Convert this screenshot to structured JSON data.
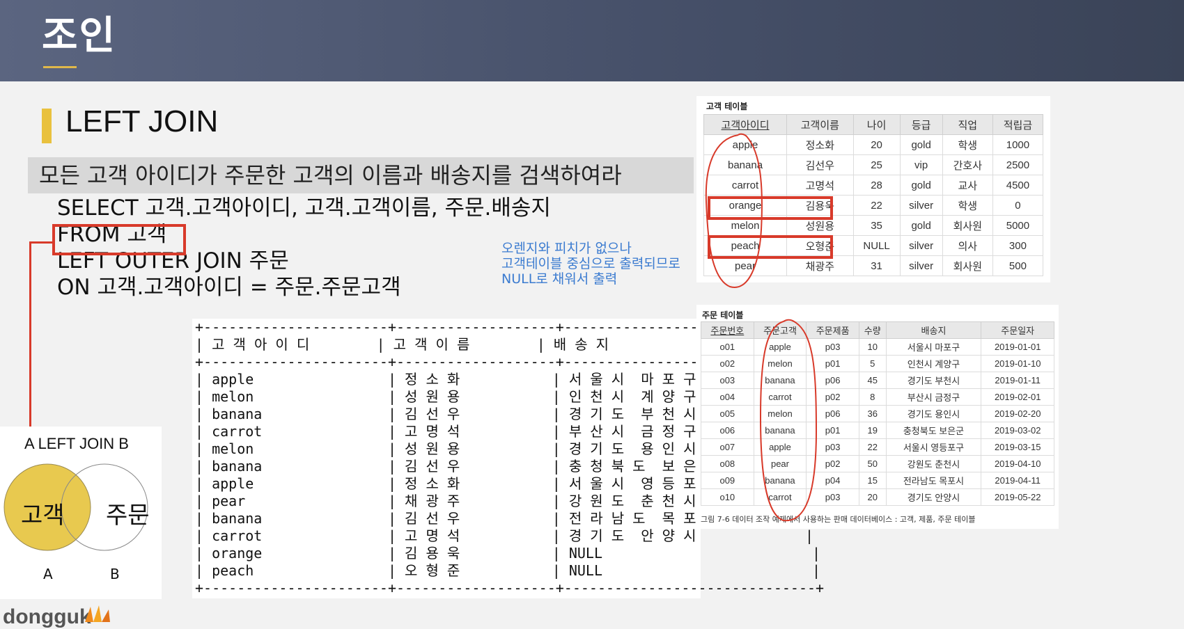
{
  "header": {
    "title": "조인"
  },
  "section": {
    "title": "LEFT JOIN"
  },
  "question": "모든 고객 아이디가 주문한 고객의 이름과 배송지를 검색하여라",
  "sql": {
    "line1": "SELECT 고객.고객아이디,  고객.고객이름,  주문.배송지",
    "line2": "FROM 고객",
    "line3": "LEFT OUTER JOIN 주문",
    "line4": "ON 고객.고객아이디 = 주문.주문고객"
  },
  "note": {
    "line1": "오렌지와 피치가 없으나",
    "line2": "고객테이블 중심으로 출력되므로",
    "line3": "NULL로 채워서 출력"
  },
  "result_text": "+----------------------+-------------------+------------------------------+\n| 고 객 아 이 디        | 고 객 이 름        | 배 송 지                      |\n+----------------------+-------------------+------------------------------+\n| apple                | 정 소 화           | 서 울 시  마 포 구             |\n| melon                | 성 원 용           | 인 천 시  계 양 구             |\n| banana               | 김 선 우           | 경 기 도  부 천 시             |\n| carrot               | 고 명 석           | 부 산 시  금 정 구             |\n| melon                | 성 원 용           | 경 기 도  용 인 시             |\n| banana               | 김 선 우           | 충 청 북 도  보 은 군          |\n| apple                | 정 소 화           | 서 울 시  영 등 포 구          |\n| pear                 | 채 광 주           | 강 원 도  춘 천 시             |\n| banana               | 김 선 우           | 전 라 남 도  목 포 시          |\n| carrot               | 고 명 석           | 경 기 도  안 양 시             |\n| orange               | 김 용 욱           | NULL                         |\n| peach                | 오 형 준           | NULL                         |\n+----------------------+-------------------+------------------------------+",
  "venn": {
    "title": "A LEFT JOIN B",
    "left": "고객",
    "right": "주문",
    "label_a": "A",
    "label_b": "B",
    "fill_color": "#e8c94f"
  },
  "customer_table": {
    "caption": "고객 테이블",
    "headers": [
      "고객아이디",
      "고객이름",
      "나이",
      "등급",
      "직업",
      "적립금"
    ],
    "rows": [
      [
        "apple",
        "정소화",
        "20",
        "gold",
        "학생",
        "1000"
      ],
      [
        "banana",
        "김선우",
        "25",
        "vip",
        "간호사",
        "2500"
      ],
      [
        "carrot",
        "고명석",
        "28",
        "gold",
        "교사",
        "4500"
      ],
      [
        "orange",
        "김용욱",
        "22",
        "silver",
        "학생",
        "0"
      ],
      [
        "melon",
        "성원용",
        "35",
        "gold",
        "회사원",
        "5000"
      ],
      [
        "peach",
        "오형준",
        "NULL",
        "silver",
        "의사",
        "300"
      ],
      [
        "pear",
        "채광주",
        "31",
        "silver",
        "회사원",
        "500"
      ]
    ]
  },
  "order_table": {
    "caption": "주문 테이블",
    "headers": [
      "주문번호",
      "주문고객",
      "주문제품",
      "수량",
      "배송지",
      "주문일자"
    ],
    "rows": [
      [
        "o01",
        "apple",
        "p03",
        "10",
        "서울시 마포구",
        "2019-01-01"
      ],
      [
        "o02",
        "melon",
        "p01",
        "5",
        "인천시 계양구",
        "2019-01-10"
      ],
      [
        "o03",
        "banana",
        "p06",
        "45",
        "경기도 부천시",
        "2019-01-11"
      ],
      [
        "o04",
        "carrot",
        "p02",
        "8",
        "부산시 금정구",
        "2019-02-01"
      ],
      [
        "o05",
        "melon",
        "p06",
        "36",
        "경기도 용인시",
        "2019-02-20"
      ],
      [
        "o06",
        "banana",
        "p01",
        "19",
        "충청북도 보은군",
        "2019-03-02"
      ],
      [
        "o07",
        "apple",
        "p03",
        "22",
        "서울시 영등포구",
        "2019-03-15"
      ],
      [
        "o08",
        "pear",
        "p02",
        "50",
        "강원도 춘천시",
        "2019-04-10"
      ],
      [
        "o09",
        "banana",
        "p04",
        "15",
        "전라남도 목포시",
        "2019-04-11"
      ],
      [
        "o10",
        "carrot",
        "p03",
        "20",
        "경기도 안양시",
        "2019-05-22"
      ]
    ],
    "figure_caption": "그림 7-6  데이터 조작 예제에서 사용하는 판매 데이터베이스 : 고객, 제품, 주문 테이블"
  },
  "logo": {
    "text": "dongguk"
  },
  "colors": {
    "accent": "#e9c13e",
    "highlight": "#d83a2a",
    "note": "#3b7bd0"
  }
}
